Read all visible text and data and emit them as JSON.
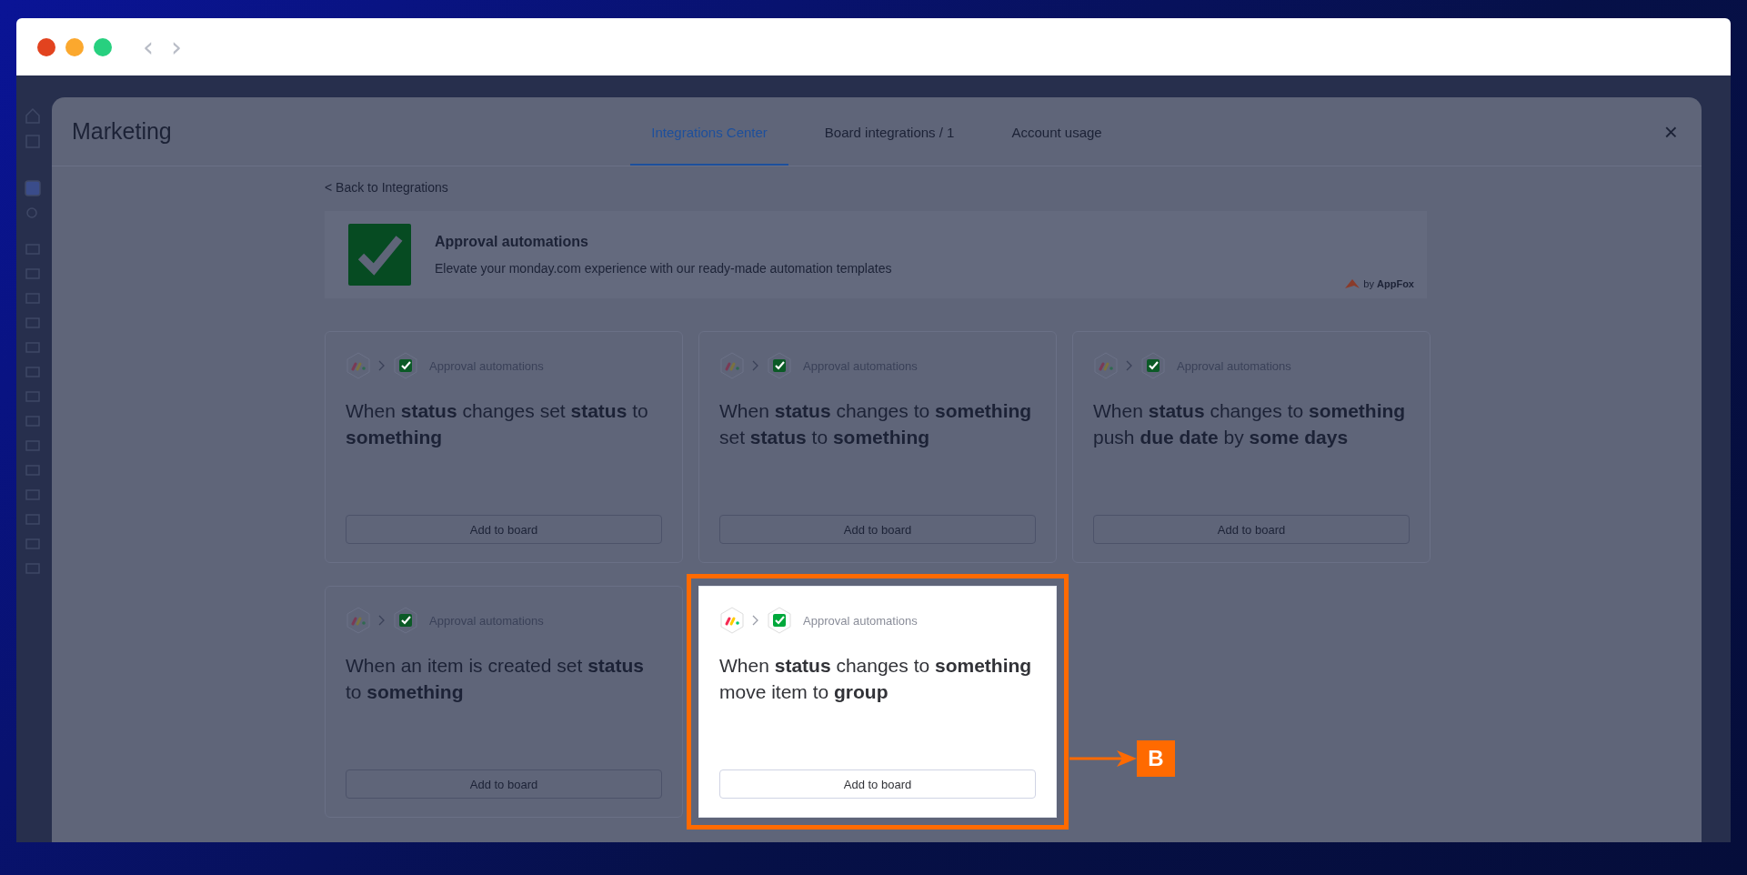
{
  "browser": {
    "back": "‹",
    "forward": "›"
  },
  "modal": {
    "title": "Marketing",
    "tabs": [
      {
        "label": "Integrations Center",
        "selected": true
      },
      {
        "label": "Board integrations / 1",
        "selected": false
      },
      {
        "label": "Account usage",
        "selected": false
      }
    ],
    "close": "×",
    "back_link": "< Back to Integrations",
    "app": {
      "name": "Approval automations",
      "description": "Elevate your monday.com experience with our ready-made automation templates",
      "vendor_prefix": "by",
      "vendor": "AppFox"
    },
    "cards": [
      {
        "source": "Approval automations",
        "title": "When **status** changes set **status** to **something**",
        "button": "Add to board",
        "highlighted": false
      },
      {
        "source": "Approval automations",
        "title": "When **status** changes to **something** set **status** to **something**",
        "button": "Add to board",
        "highlighted": false
      },
      {
        "source": "Approval automations",
        "title": "When **status** changes to **something** push **due date** by **some days**",
        "button": "Add to board",
        "highlighted": false
      },
      {
        "source": "Approval automations",
        "title": "When an item is created set **status** to **something**",
        "button": "Add to board",
        "highlighted": false
      },
      {
        "source": "Approval automations",
        "title": "When **status** changes to **something** move item to **group**",
        "button": "Add to board",
        "highlighted": true,
        "callout": "B"
      }
    ]
  }
}
